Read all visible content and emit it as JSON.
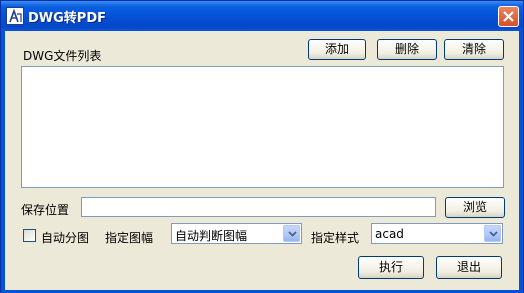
{
  "window": {
    "title": "DWG转PDF",
    "app_icon": "autocad-app-icon",
    "close_icon": "close-icon"
  },
  "file_list": {
    "label": "DWG文件列表",
    "add_button": "添加",
    "delete_button": "删除",
    "clear_button": "清除",
    "items": []
  },
  "save_location": {
    "label": "保存位置",
    "value": "",
    "browse_button": "浏览"
  },
  "options": {
    "auto_split_label": "自动分图",
    "auto_split_checked": false,
    "paper_size_label": "指定图幅",
    "paper_size_value": "自动判断图幅",
    "style_label": "指定样式",
    "style_value": "acad"
  },
  "actions": {
    "execute_button": "执行",
    "exit_button": "退出"
  },
  "colors": {
    "titlebar": "#0552d8",
    "dialog_background": "#ece9d8",
    "button_border": "#003c74",
    "field_border": "#7f9db9",
    "close_button": "#d4502a"
  }
}
